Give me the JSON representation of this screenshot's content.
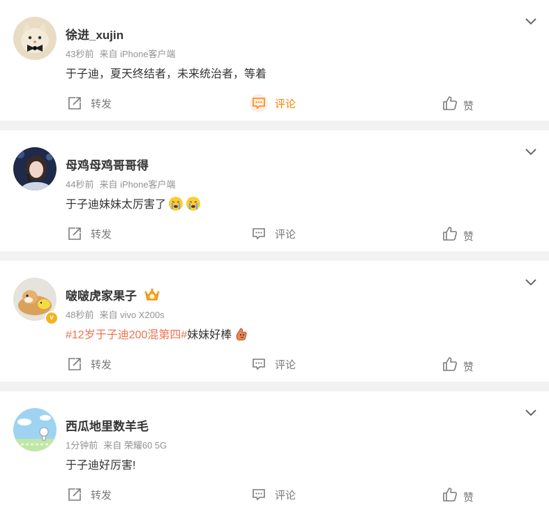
{
  "posts": [
    {
      "username": "徐进_xujin",
      "time": "43秒前",
      "source": "来自 iPhone客户端",
      "text": "于子迪，夏天终结者，未来统治者，等着",
      "topic": "",
      "avatar_icon": "cat-with-bowtie-avatar",
      "verified": false,
      "vip_badge": false,
      "emojis": [],
      "comment_active": true
    },
    {
      "username": "母鸡母鸡哥哥得",
      "time": "44秒前",
      "source": "来自 iPhone客户端",
      "text": "于子迪妹妹太厉害了",
      "topic": "",
      "avatar_icon": "singer-portrait-avatar",
      "verified": false,
      "vip_badge": false,
      "emojis": [
        "crying-face-emoji",
        "crying-face-emoji"
      ],
      "comment_active": false
    },
    {
      "username": "啵啵虎家果子",
      "time": "48秒前",
      "source": "来自 vivo X200s",
      "text": "妹妹好棒",
      "topic": "#12岁于子迪200混第四#",
      "avatar_icon": "dog-with-toy-avatar",
      "verified": true,
      "vip_badge": true,
      "emojis": [
        "thumbs-up-meat-emoji"
      ],
      "comment_active": false
    },
    {
      "username": "西瓜地里数羊毛",
      "time": "1分钟前",
      "source": "来自 荣耀60 5G",
      "text": "于子迪好厉害!",
      "topic": "",
      "avatar_icon": "sky-cartoon-avatar",
      "verified": false,
      "vip_badge": false,
      "emojis": [],
      "comment_active": false
    }
  ],
  "actions": {
    "repost": "转发",
    "comment": "评论",
    "like": "赞"
  },
  "colors": {
    "topic": "#eb7350",
    "active_comment": "#ff8200",
    "meta": "#939393",
    "separator": "#f2f2f2"
  }
}
